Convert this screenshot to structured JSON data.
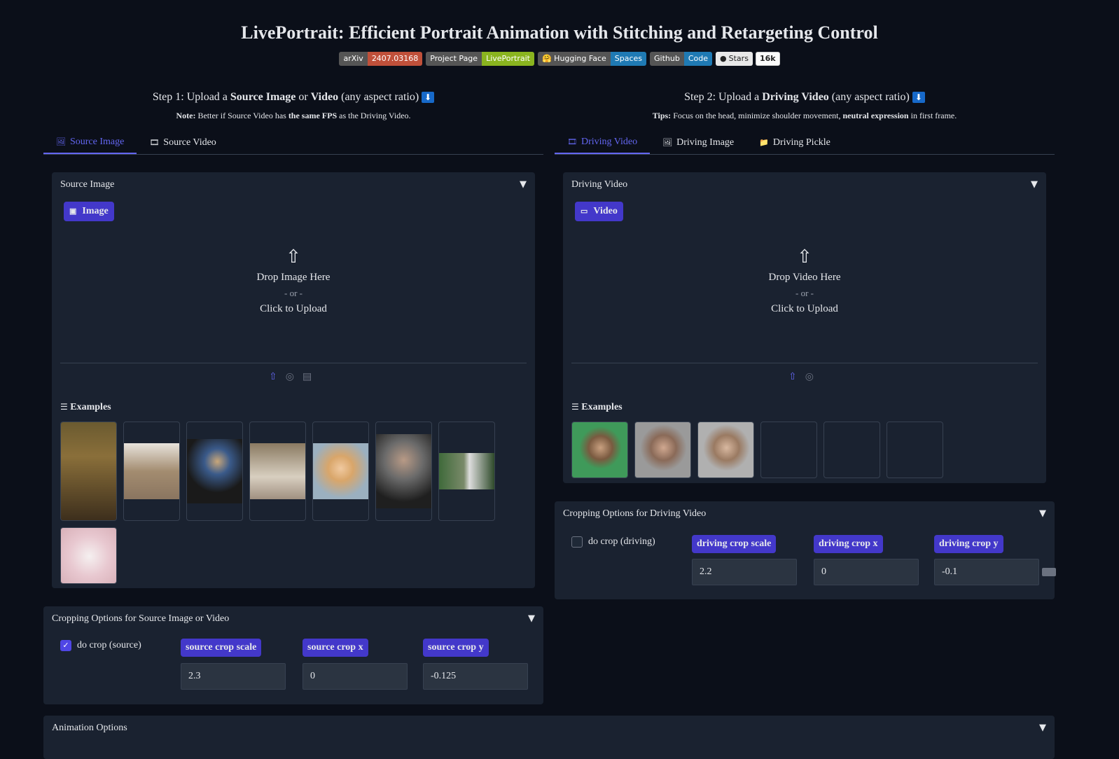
{
  "title": "LivePortrait: Efficient Portrait Animation with Stitching and Retargeting Control",
  "badges": {
    "arxiv_label": "arXiv",
    "arxiv_value": "2407.03168",
    "project_label": "Project Page",
    "project_value": "LivePortrait",
    "hf_label": "Hugging Face",
    "hf_value": "Spaces",
    "github_label": "Github",
    "github_value": "Code",
    "stars_label": "Stars",
    "stars_count": "16k"
  },
  "step1": {
    "heading_pre": "Step 1: Upload a ",
    "heading_b1": "Source Image",
    "heading_mid": " or ",
    "heading_b2": "Video",
    "heading_post": " (any aspect ratio)",
    "note_label": "Note:",
    "note_text1": " Better if Source Video has ",
    "note_bold": "the same FPS",
    "note_text2": " as the Driving Video.",
    "tabs": [
      "Source Image",
      "Source Video"
    ],
    "panel_title": "Source Image",
    "pill": "Image",
    "drop_line1": "Drop Image Here",
    "drop_or": "- or -",
    "drop_line2": "Click to Upload",
    "examples": "Examples"
  },
  "step2": {
    "heading_pre": "Step 2: Upload a ",
    "heading_b1": "Driving Video",
    "heading_post": " (any aspect ratio)",
    "tips_label": "Tips:",
    "tips_text1": " Focus on the head, minimize shoulder movement, ",
    "tips_bold": "neutral expression",
    "tips_text2": " in first frame.",
    "tabs": [
      "Driving Video",
      "Driving Image",
      "Driving Pickle"
    ],
    "panel_title": "Driving Video",
    "pill": "Video",
    "drop_line1": "Drop Video Here",
    "drop_or": "- or -",
    "drop_line2": "Click to Upload",
    "examples": "Examples"
  },
  "crop_source": {
    "title": "Cropping Options for Source Image or Video",
    "checkbox": "do crop (source)",
    "checked": true,
    "scale_label": "source crop scale",
    "scale_value": "2.3",
    "x_label": "source crop x",
    "x_value": "0",
    "y_label": "source crop y",
    "y_value": "-0.125"
  },
  "crop_driving": {
    "title": "Cropping Options for Driving Video",
    "checkbox": "do crop (driving)",
    "checked": false,
    "scale_label": "driving crop scale",
    "scale_value": "2.2",
    "x_label": "driving crop x",
    "x_value": "0",
    "y_label": "driving crop y",
    "y_value": "-0.1"
  },
  "animation_options": {
    "title": "Animation Options"
  },
  "colors": {
    "accent": "#6366f1",
    "pill": "#4338ca",
    "background": "#0b0f19",
    "panel": "#1a2230"
  }
}
